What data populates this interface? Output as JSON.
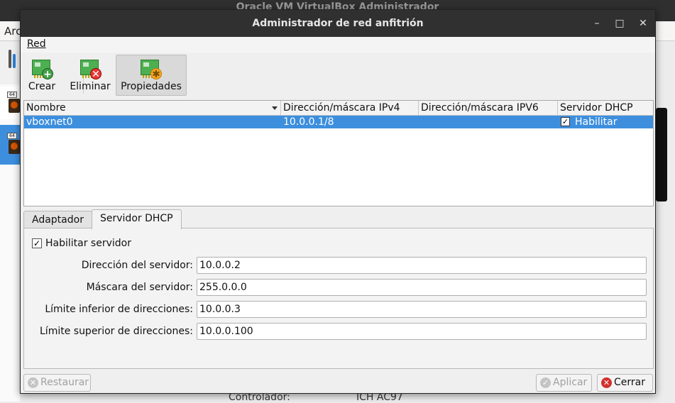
{
  "background": {
    "title": "Oracle VM VirtualBox Administrador",
    "menu_first": "Arc",
    "detail_key": "Controlador:",
    "detail_value": "ICH AC97",
    "vm_badge": "64"
  },
  "dialog": {
    "title": "Administrador de red anfitrión",
    "window_controls": {
      "minimize": "–",
      "maximize": "□",
      "close": "✕"
    },
    "menu": {
      "red_label": "Red"
    },
    "toolbar": {
      "crear": "Crear",
      "eliminar": "Eliminar",
      "propiedades": "Propiedades"
    },
    "table": {
      "headers": [
        "Nombre",
        "Dirección/máscara IPv4",
        "Dirección/máscara IPV6",
        "Servidor DHCP"
      ],
      "rows": [
        {
          "nombre": "vboxnet0",
          "ipv4": "10.0.0.1/8",
          "ipv6": "",
          "dhcp_label": "Habilitar",
          "dhcp_checked": true
        }
      ]
    },
    "tabs": [
      "Adaptador",
      "Servidor DHCP"
    ],
    "dhcp": {
      "enable_label": "Habilitar servidor",
      "enabled": true,
      "fields": [
        {
          "label": "Dirección del servidor:",
          "value": "10.0.0.2"
        },
        {
          "label": "Máscara del servidor:",
          "value": "255.0.0.0"
        },
        {
          "label": "Límite inferior de direcciones:",
          "value": "10.0.0.3"
        },
        {
          "label": "Límite superior de direcciones:",
          "value": "10.0.0.100"
        }
      ]
    },
    "buttons": {
      "restaurar": "Restaurar",
      "aplicar": "Aplicar",
      "cerrar": "Cerrar"
    },
    "check_glyph": "✓",
    "colors": {
      "selection": "#3d8fde",
      "titlebar": "#303030",
      "close_red": "#d32f2f"
    }
  }
}
